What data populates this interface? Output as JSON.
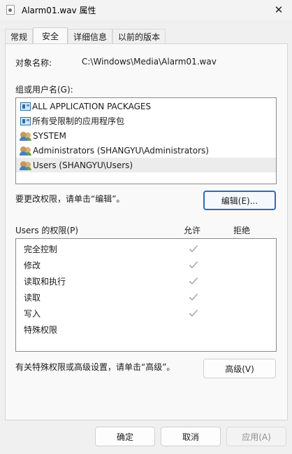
{
  "window": {
    "title": "Alarm01.wav 属性",
    "close_symbol": "✕"
  },
  "tabs": [
    {
      "label": "常规",
      "active": false
    },
    {
      "label": "安全",
      "active": true
    },
    {
      "label": "详细信息",
      "active": false
    },
    {
      "label": "以前的版本",
      "active": false
    }
  ],
  "object": {
    "label": "对象名称:",
    "value": "C:\\Windows\\Media\\Alarm01.wav"
  },
  "groups": {
    "label": "组或用户名(G):",
    "items": [
      {
        "name": "ALL APPLICATION PACKAGES",
        "icon": "package-icon",
        "selected": false
      },
      {
        "name": "所有受限制的应用程序包",
        "icon": "package-icon",
        "selected": false
      },
      {
        "name": "SYSTEM",
        "icon": "users-icon",
        "selected": false
      },
      {
        "name": "Administrators (SHANGYU\\Administrators)",
        "icon": "users-icon",
        "selected": false
      },
      {
        "name": "Users (SHANGYU\\Users)",
        "icon": "users-icon",
        "selected": true
      }
    ]
  },
  "edit": {
    "hint": "要更改权限，请单击“编辑”。",
    "button": "编辑(E)..."
  },
  "permissions": {
    "title": "Users 的权限(P)",
    "allow_header": "允许",
    "deny_header": "拒绝",
    "rows": [
      {
        "name": "完全控制",
        "allow": true,
        "deny": false
      },
      {
        "name": "修改",
        "allow": true,
        "deny": false
      },
      {
        "name": "读取和执行",
        "allow": true,
        "deny": false
      },
      {
        "name": "读取",
        "allow": true,
        "deny": false
      },
      {
        "name": "写入",
        "allow": true,
        "deny": false
      },
      {
        "name": "特殊权限",
        "allow": false,
        "deny": false
      }
    ],
    "check_color": "#a8a8a8"
  },
  "advanced": {
    "hint": "有关特殊权限或高级设置，请单击“高级”。",
    "button": "高级(V)"
  },
  "footer": {
    "ok": "确定",
    "cancel": "取消",
    "apply": "应用(A)"
  }
}
